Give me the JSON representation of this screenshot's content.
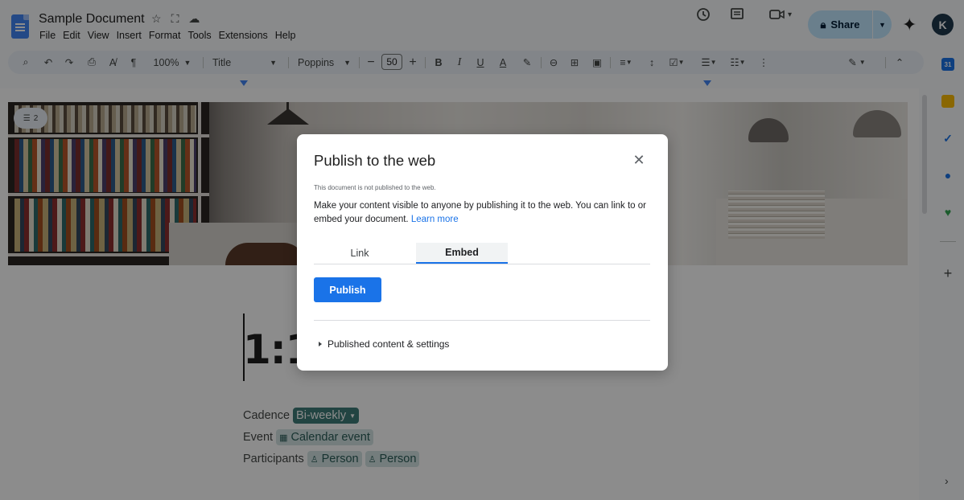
{
  "window": {
    "doc_title": "Sample Document",
    "menus": [
      "File",
      "Edit",
      "View",
      "Insert",
      "Format",
      "Tools",
      "Extensions",
      "Help"
    ],
    "share_label": "Share",
    "avatar_initial": "K"
  },
  "toolbar": {
    "zoom": "100%",
    "style": "Title",
    "font": "Poppins",
    "font_size": "50"
  },
  "document": {
    "comment_count": "2",
    "heading": "1:1",
    "cadence_label": "Cadence",
    "cadence_value": "Bi-weekly",
    "event_label": "Event",
    "event_value": "Calendar event",
    "participants_label": "Participants",
    "participant_1": "Person",
    "participant_2": "Person"
  },
  "dialog": {
    "title": "Publish to the web",
    "status": "This document is not published to the web.",
    "description": "Make your content visible to anyone by publishing it to the web. You can link to or embed your document.",
    "learn_more": "Learn more",
    "tabs": [
      "Link",
      "Embed"
    ],
    "active_tab": "Embed",
    "publish_label": "Publish",
    "settings_label": "Published content & settings"
  },
  "colors": {
    "accent": "#1a73e8",
    "share_bg": "#c2e7ff",
    "chip_bg": "#d3e3e4",
    "chip_dark": "#3f7d78"
  }
}
